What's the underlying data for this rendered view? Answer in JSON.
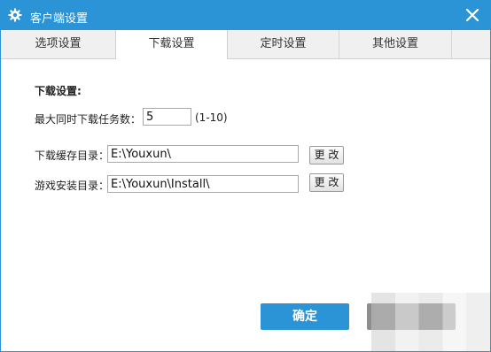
{
  "window": {
    "title": "客户端设置"
  },
  "icons": {
    "title": "gear-icon",
    "close": "close-icon"
  },
  "colors": {
    "accent": "#2a94d6",
    "tab_bar": "#f0f0f0",
    "cancel": "#8e8e8e"
  },
  "tabs": [
    {
      "label": "选项设置",
      "active": false
    },
    {
      "label": "下载设置",
      "active": true
    },
    {
      "label": "定时设置",
      "active": false
    },
    {
      "label": "其他设置",
      "active": false
    }
  ],
  "download": {
    "section_title": "下载设置:",
    "max_tasks_label": "最大同时下载任务数：",
    "max_tasks_value": "5",
    "max_tasks_range": "(1-10)",
    "cache_dir_label": "下载缓存目录：",
    "cache_dir_value": "E:\\Youxun\\",
    "install_dir_label": "游戏安装目录：",
    "install_dir_value": "E:\\Youxun\\Install\\",
    "change_label": "更 改"
  },
  "footer": {
    "ok_label": "确定"
  }
}
